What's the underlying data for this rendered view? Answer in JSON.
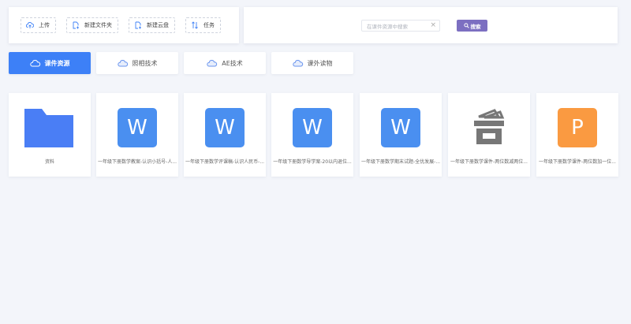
{
  "toolbar": {
    "upload_label": "上传",
    "new_folder_label": "新建文件夹",
    "new_cloud_disk_label": "新建云盘",
    "tasks_label": "任务"
  },
  "search": {
    "placeholder": "在课件资源中搜索",
    "button_label": "搜索",
    "clear_glyph": "×"
  },
  "tabs": [
    {
      "label": "课件资源",
      "active": true
    },
    {
      "label": "照相技术",
      "active": false
    },
    {
      "label": "AE技术",
      "active": false
    },
    {
      "label": "课外读物",
      "active": false
    }
  ],
  "files": [
    {
      "name": "资料",
      "type": "folder"
    },
    {
      "name": "一年级下册数学教案-认识小括号-人...",
      "type": "word",
      "glyph": "W"
    },
    {
      "name": "一年级下册数学评课稿-认识人民币-...",
      "type": "word",
      "glyph": "W"
    },
    {
      "name": "一年级下册数学导学案-20以内退位...",
      "type": "word",
      "glyph": "W"
    },
    {
      "name": "一年级下册数学期末试题-全优发展-...",
      "type": "word",
      "glyph": "W"
    },
    {
      "name": "一年级下册数学课件-两位数减两位...",
      "type": "archive"
    },
    {
      "name": "一年级下册数学课件-两位数加一位...",
      "type": "ppt",
      "glyph": "P"
    }
  ],
  "colors": {
    "accent": "#3d80f7",
    "search_button": "#7c6fc1",
    "word": "#4a8ff0",
    "ppt": "#fa9a41",
    "folder": "#4a7ef5"
  }
}
